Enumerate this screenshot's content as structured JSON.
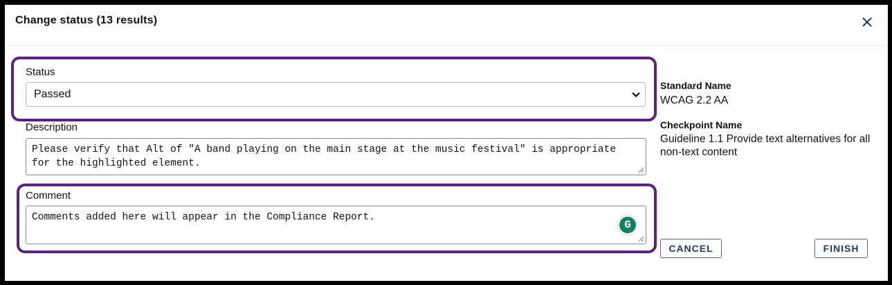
{
  "dialog": {
    "title": "Change status (13 results)",
    "close_icon": "close-icon"
  },
  "status": {
    "label": "Status",
    "value": "Passed",
    "chevron_icon": "chevron-down-icon"
  },
  "description": {
    "label": "Description",
    "value": "Please verify that Alt of \"A band playing on the main stage at the music festival\" is appropriate for the highlighted element."
  },
  "comment": {
    "label": "Comment",
    "placeholder": "Comments added here will appear in the Compliance Report.",
    "grammarly_letter": "G",
    "grammarly_icon": "grammarly-icon"
  },
  "details": {
    "standard_label": "Standard Name",
    "standard_value": "WCAG 2.2 AA",
    "checkpoint_label": "Checkpoint Name",
    "checkpoint_value": "Guideline 1.1 Provide text alternatives for all non-text content"
  },
  "buttons": {
    "cancel": "CANCEL",
    "finish": "FINISH"
  },
  "colors": {
    "highlight": "#5b2183",
    "button_text": "#1f3a5a",
    "grammarly": "#15805e"
  }
}
